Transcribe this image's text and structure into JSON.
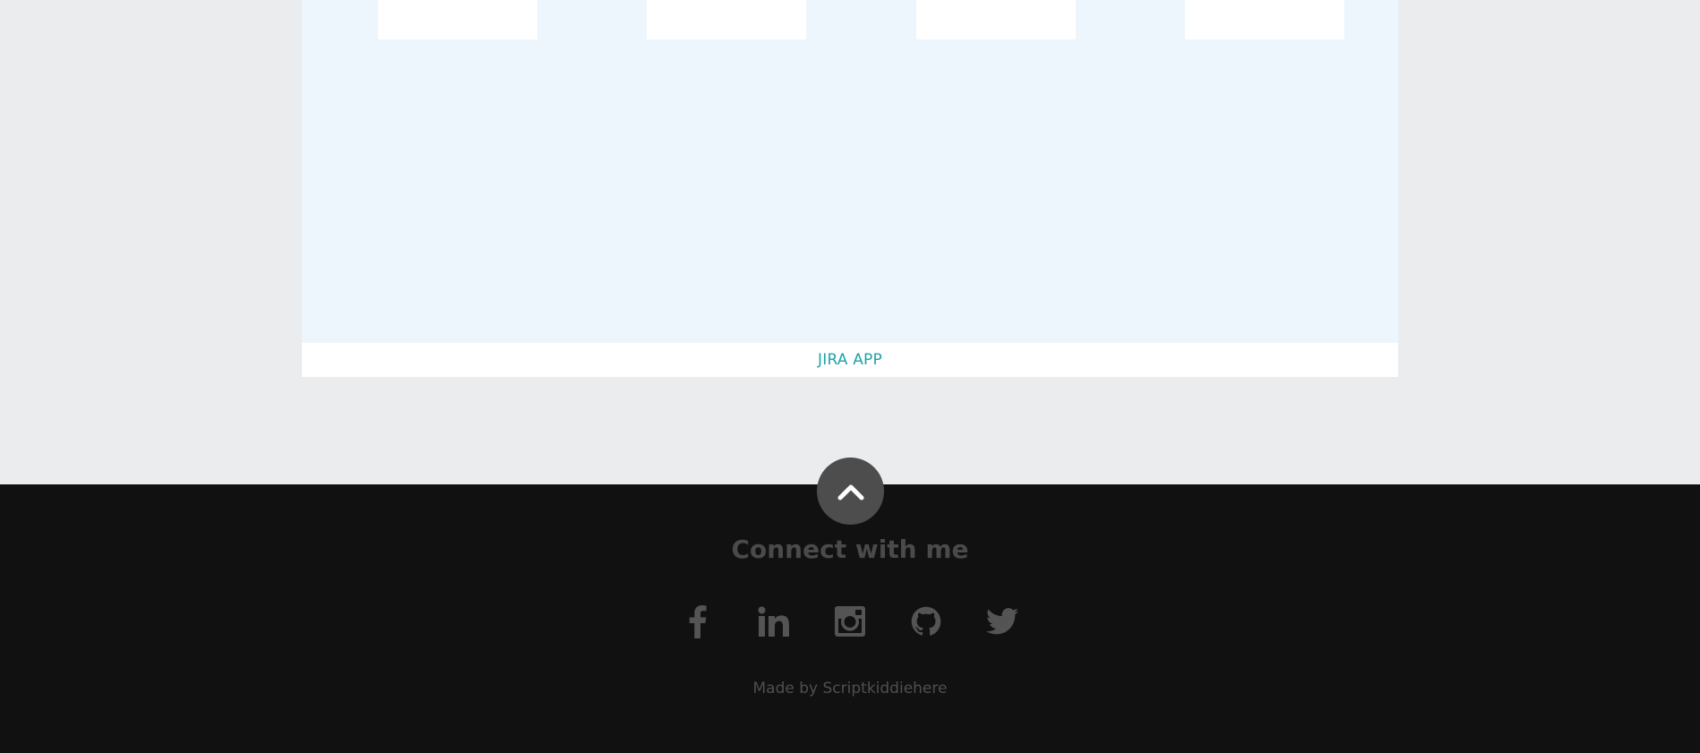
{
  "project": {
    "link_label": "JIRA APP"
  },
  "footer": {
    "back_to_top_icon": "chevron-up-icon",
    "title": "Connect with me",
    "socials": [
      {
        "name": "facebook-icon"
      },
      {
        "name": "linkedin-icon"
      },
      {
        "name": "instagram-icon"
      },
      {
        "name": "github-icon"
      },
      {
        "name": "twitter-icon"
      }
    ],
    "credit": "Made by Scriptkiddiehere"
  },
  "colors": {
    "page_bg": "#ebecee",
    "preview_bg": "#eef6fd",
    "accent": "#1ea3a8",
    "footer_bg": "#111111",
    "footer_text": "#4a4a4a"
  }
}
